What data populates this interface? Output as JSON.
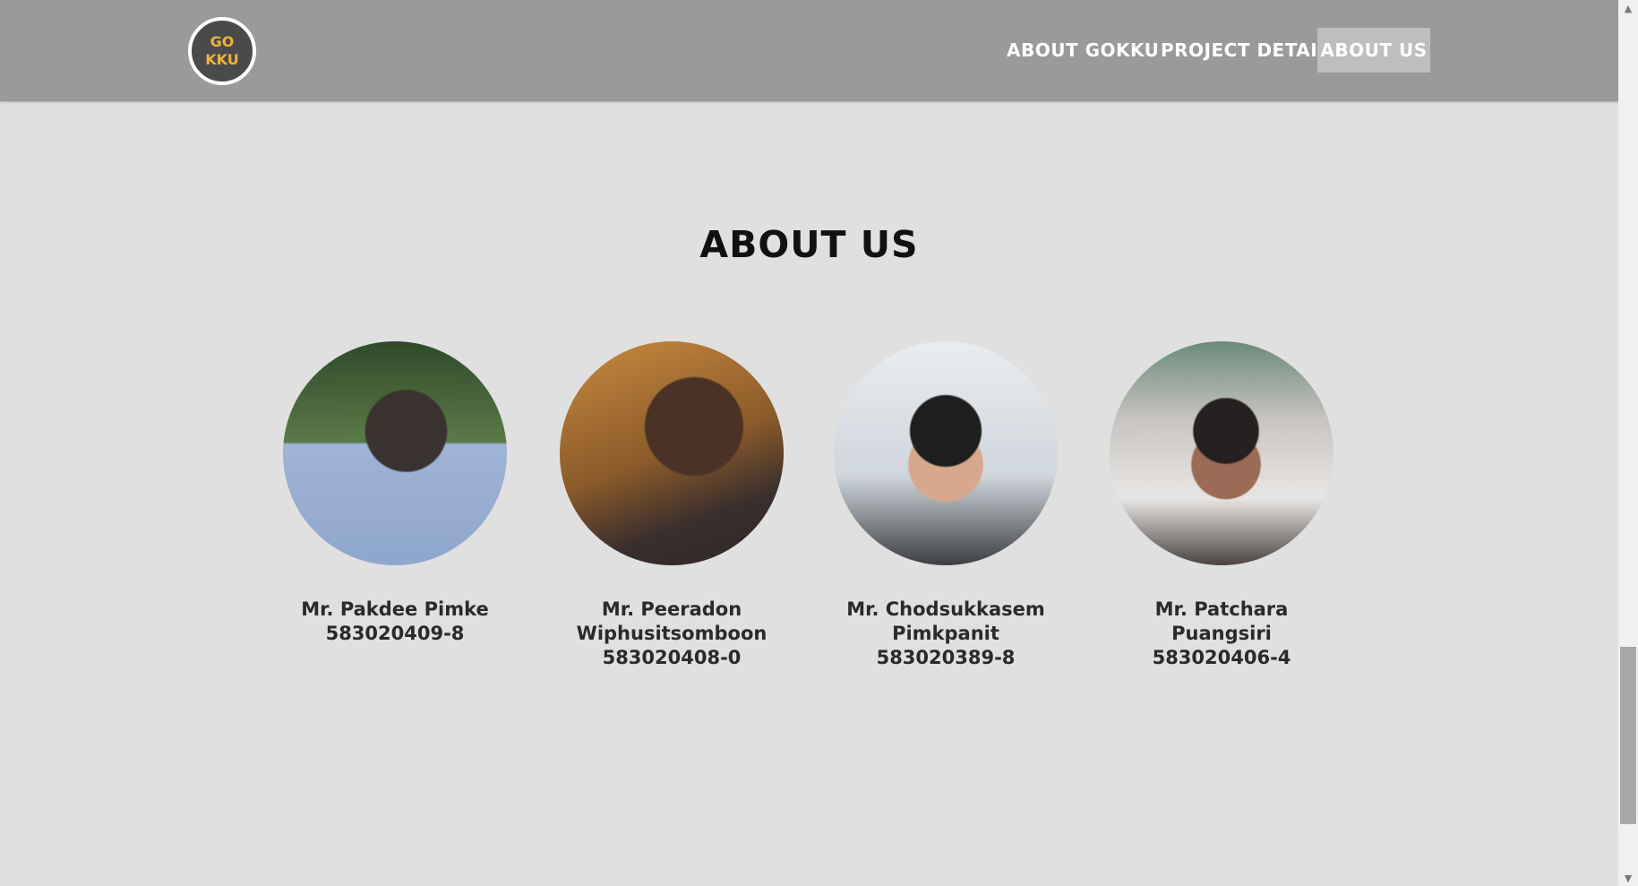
{
  "logo": {
    "line1": "GO",
    "line2": "KKU"
  },
  "nav": {
    "items": [
      {
        "label": "ABOUT GOKKU"
      },
      {
        "label": "PROJECT DETAIL"
      },
      {
        "label": "ABOUT US",
        "active": true
      }
    ]
  },
  "page": {
    "heading": "ABOUT US"
  },
  "members": [
    {
      "name": "Mr. Pakdee  Pimke\n583020409-8"
    },
    {
      "name": "Mr. Peeradon\nWiphusitsomboon\n583020408-0"
    },
    {
      "name": "Mr. Chodsukkasem\nPimkpanit\n583020389-8"
    },
    {
      "name": "Mr. Patchara Puangsiri\n583020406-4"
    }
  ],
  "colors": {
    "navbar": "#9a9a9a",
    "background": "#e0e0e0",
    "logo_text": "#f0b33a",
    "active_nav": "#bebebe"
  },
  "icons": {
    "scroll_up": "chevron-up-icon",
    "scroll_down": "chevron-down-icon"
  }
}
